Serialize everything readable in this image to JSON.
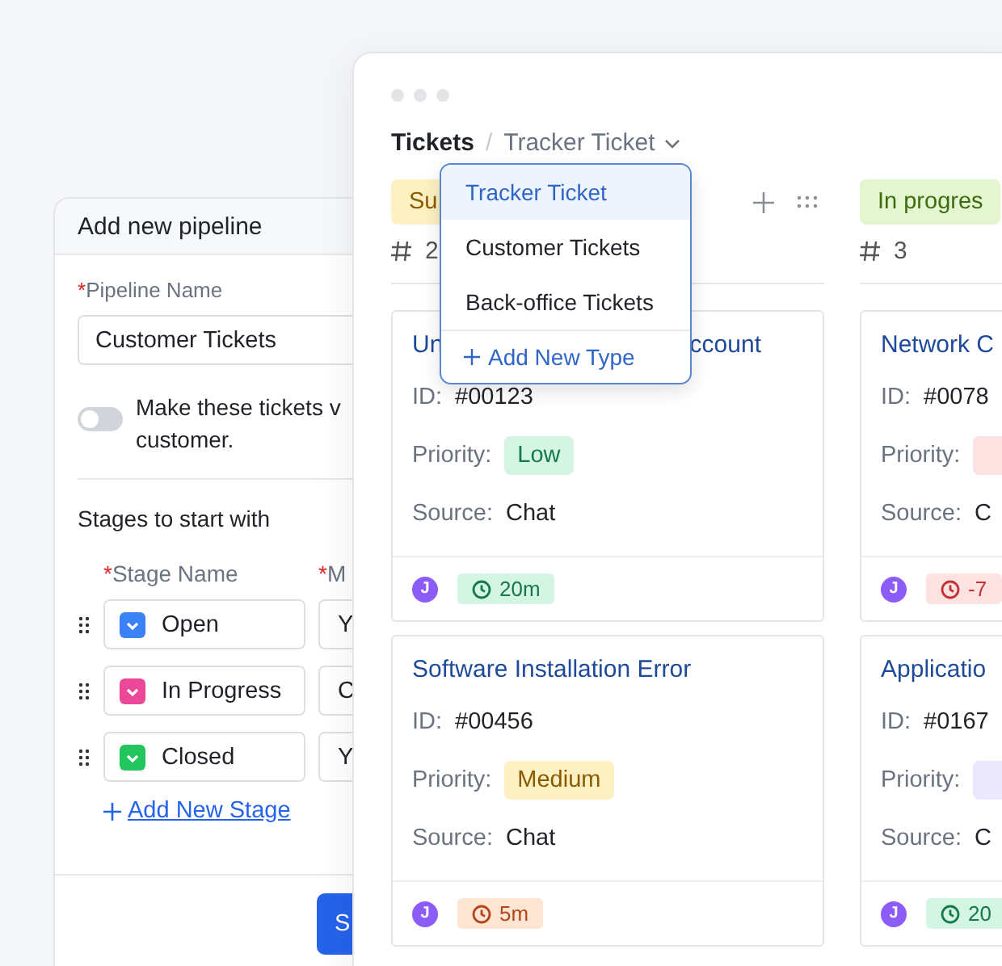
{
  "pipeline_panel": {
    "title": "Add new pipeline",
    "required_mark": "*",
    "name_label": "Pipeline Name",
    "name_value": "Customer Tickets",
    "toggle": {
      "on": false,
      "lines": [
        "Make these tickets v",
        "customer."
      ]
    },
    "stages_title": "Stages to start with",
    "columns": [
      "Stage Name",
      "M"
    ],
    "stages": [
      {
        "name": "Open",
        "color": "#3b82f6",
        "column_2": "Y"
      },
      {
        "name": "In Progress",
        "color": "#ec4899",
        "column_2": "C"
      },
      {
        "name": "Closed",
        "color": "#22c55e",
        "column_2": "Y"
      }
    ],
    "add_stage": "Add New Stage",
    "save_button": "S"
  },
  "board": {
    "breadcrumb": {
      "root": "Tickets",
      "separator": "/",
      "current": "Tracker Ticket"
    },
    "dropdown": {
      "items": [
        {
          "label": "Tracker Ticket",
          "selected": true
        },
        {
          "label": "Customer Tickets",
          "selected": false
        },
        {
          "label": "Back-office Tickets",
          "selected": false
        }
      ],
      "add_label": "Add New Type"
    },
    "columns": [
      {
        "tag": "Su",
        "color": "#fdf0c2",
        "count": "2",
        "cards": [
          {
            "title_parts": [
              "Un",
              "ccount"
            ],
            "labels": [
              "ID:",
              "Priority:",
              "Source:"
            ],
            "id": "#00123",
            "priority": {
              "text": "Low",
              "color": "#d4f4e4"
            },
            "source": "Chat",
            "avatar": "J",
            "timer": {
              "text": "20m",
              "color": "#d4f4e4"
            }
          },
          {
            "title_parts": [
              "Software Installation Error"
            ],
            "labels": [
              "ID:",
              "Priority:",
              "Source:"
            ],
            "id": "#00456",
            "priority": {
              "text": "Medium",
              "color": "#fdf0c2"
            },
            "source": "Chat",
            "avatar": "J",
            "timer": {
              "text": "5m",
              "color": "#fde5d4"
            }
          }
        ]
      },
      {
        "tag": "In progres",
        "color": "#e3f6cf",
        "count": "3",
        "cards": [
          {
            "title_parts": [
              "Network C"
            ],
            "labels": [
              "ID:",
              "Priority:",
              "Source:"
            ],
            "id": "#0078",
            "priority": {
              "color": "#fde2e2"
            },
            "source": "C",
            "avatar": "J",
            "timer": {
              "text": "-7",
              "color": "#fde2e2"
            }
          },
          {
            "title_parts": [
              "Applicatio"
            ],
            "labels": [
              "ID:",
              "Priority:",
              "Source:"
            ],
            "id": "#0167",
            "priority": {
              "color": "#ebe8fd"
            },
            "source": "C",
            "avatar": "J",
            "timer": {
              "text": "20",
              "color": "#d4f4e4"
            }
          }
        ]
      }
    ]
  }
}
